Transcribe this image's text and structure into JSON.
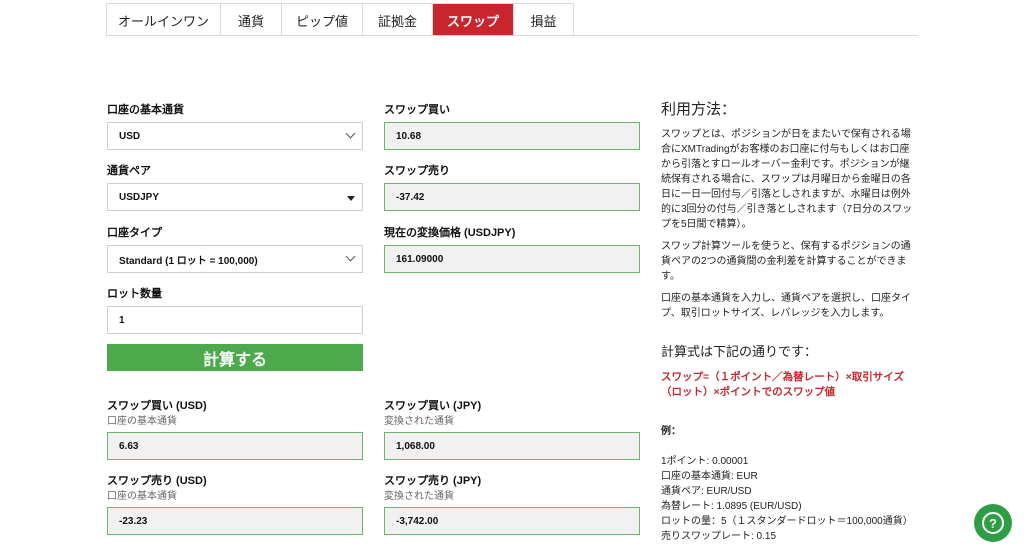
{
  "tabs": [
    {
      "label": "オールインワン",
      "active": false
    },
    {
      "label": "通貨",
      "active": false
    },
    {
      "label": "ピップ値",
      "active": false
    },
    {
      "label": "証拠金",
      "active": false
    },
    {
      "label": "スワップ",
      "active": true
    },
    {
      "label": "損益",
      "active": false
    }
  ],
  "form": {
    "base_currency_label": "口座の基本通貨",
    "base_currency_value": "USD",
    "pair_label": "通貨ペア",
    "pair_value": "USDJPY",
    "account_type_label": "口座タイプ",
    "account_type_value": "Standard (1 ロット = 100,000)",
    "lot_label": "ロット数量",
    "lot_value": "1",
    "swap_buy_label": "スワップ買い",
    "swap_buy_value": "10.68",
    "swap_sell_label": "スワップ売り",
    "swap_sell_value": "-37.42",
    "rate_label": "現在の変換価格 (USDJPY)",
    "rate_value": "161.09000",
    "calc_button": "計算する"
  },
  "results": {
    "buy_usd_label": "スワップ買い (USD)",
    "buy_usd_sub": "口座の基本通貨",
    "buy_usd_value": "6.63",
    "buy_jpy_label": "スワップ買い (JPY)",
    "buy_jpy_sub": "変換された通貨",
    "buy_jpy_value": "1,068.00",
    "sell_usd_label": "スワップ売り (USD)",
    "sell_usd_sub": "口座の基本通貨",
    "sell_usd_value": "-23.23",
    "sell_jpy_label": "スワップ売り (JPY)",
    "sell_jpy_sub": "変換された通貨",
    "sell_jpy_value": "-3,742.00"
  },
  "sidebar": {
    "heading": "利用方法：",
    "para1": "スワップとは、ポジションが日をまたいで保有される場合にXMTradingがお客様のお口座に付与もしくはお口座から引落とすロールオーバー金利です。ポジションが継続保有される場合に、スワップは月曜日から金曜日の各日に一日一回付与／引落としされますが、水曜日は例外的に3回分の付与／引き落としされます（7日分のスワップを5日間で精算）。",
    "para2": "スワップ計算ツールを使うと、保有するポジションの通貨ペアの2つの通貨間の金利差を計算することができます。",
    "para3": "口座の基本通貨を入力し、通貨ペアを選択し、口座タイプ、取引ロットサイズ、レバレッジを入力します。",
    "formula_heading": "計算式は下記の通りです：",
    "formula": "スワップ=（１ポイント／為替レート）×取引サイズ（ロット）×ポイントでのスワップ値",
    "example_heading": "例：",
    "example_lines": [
      "1ポイント: 0.00001",
      "口座の基本通貨: EUR",
      "通貨ペア: EUR/USD",
      "為替レート: 1.0895 (EUR/USD)",
      "ロットの量：5（１スタンダードロット＝100,000通貨）",
      "売りスワップレート: 0.15"
    ]
  },
  "help_icon": "?",
  "colors": {
    "accent_red": "#c8262c",
    "button_green": "#4caa4c",
    "output_border": "#6cb56c",
    "help_green": "#2e9e44"
  }
}
